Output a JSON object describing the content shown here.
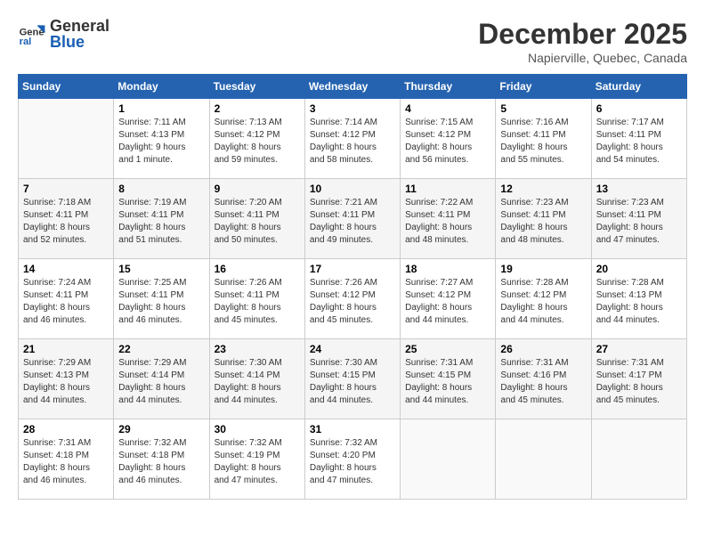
{
  "header": {
    "logo_general": "General",
    "logo_blue": "Blue",
    "month_title": "December 2025",
    "location": "Napierville, Quebec, Canada"
  },
  "days_of_week": [
    "Sunday",
    "Monday",
    "Tuesday",
    "Wednesday",
    "Thursday",
    "Friday",
    "Saturday"
  ],
  "weeks": [
    [
      {
        "day": "",
        "info": ""
      },
      {
        "day": "1",
        "info": "Sunrise: 7:11 AM\nSunset: 4:13 PM\nDaylight: 9 hours\nand 1 minute."
      },
      {
        "day": "2",
        "info": "Sunrise: 7:13 AM\nSunset: 4:12 PM\nDaylight: 8 hours\nand 59 minutes."
      },
      {
        "day": "3",
        "info": "Sunrise: 7:14 AM\nSunset: 4:12 PM\nDaylight: 8 hours\nand 58 minutes."
      },
      {
        "day": "4",
        "info": "Sunrise: 7:15 AM\nSunset: 4:12 PM\nDaylight: 8 hours\nand 56 minutes."
      },
      {
        "day": "5",
        "info": "Sunrise: 7:16 AM\nSunset: 4:11 PM\nDaylight: 8 hours\nand 55 minutes."
      },
      {
        "day": "6",
        "info": "Sunrise: 7:17 AM\nSunset: 4:11 PM\nDaylight: 8 hours\nand 54 minutes."
      }
    ],
    [
      {
        "day": "7",
        "info": "Sunrise: 7:18 AM\nSunset: 4:11 PM\nDaylight: 8 hours\nand 52 minutes."
      },
      {
        "day": "8",
        "info": "Sunrise: 7:19 AM\nSunset: 4:11 PM\nDaylight: 8 hours\nand 51 minutes."
      },
      {
        "day": "9",
        "info": "Sunrise: 7:20 AM\nSunset: 4:11 PM\nDaylight: 8 hours\nand 50 minutes."
      },
      {
        "day": "10",
        "info": "Sunrise: 7:21 AM\nSunset: 4:11 PM\nDaylight: 8 hours\nand 49 minutes."
      },
      {
        "day": "11",
        "info": "Sunrise: 7:22 AM\nSunset: 4:11 PM\nDaylight: 8 hours\nand 48 minutes."
      },
      {
        "day": "12",
        "info": "Sunrise: 7:23 AM\nSunset: 4:11 PM\nDaylight: 8 hours\nand 48 minutes."
      },
      {
        "day": "13",
        "info": "Sunrise: 7:23 AM\nSunset: 4:11 PM\nDaylight: 8 hours\nand 47 minutes."
      }
    ],
    [
      {
        "day": "14",
        "info": "Sunrise: 7:24 AM\nSunset: 4:11 PM\nDaylight: 8 hours\nand 46 minutes."
      },
      {
        "day": "15",
        "info": "Sunrise: 7:25 AM\nSunset: 4:11 PM\nDaylight: 8 hours\nand 46 minutes."
      },
      {
        "day": "16",
        "info": "Sunrise: 7:26 AM\nSunset: 4:11 PM\nDaylight: 8 hours\nand 45 minutes."
      },
      {
        "day": "17",
        "info": "Sunrise: 7:26 AM\nSunset: 4:12 PM\nDaylight: 8 hours\nand 45 minutes."
      },
      {
        "day": "18",
        "info": "Sunrise: 7:27 AM\nSunset: 4:12 PM\nDaylight: 8 hours\nand 44 minutes."
      },
      {
        "day": "19",
        "info": "Sunrise: 7:28 AM\nSunset: 4:12 PM\nDaylight: 8 hours\nand 44 minutes."
      },
      {
        "day": "20",
        "info": "Sunrise: 7:28 AM\nSunset: 4:13 PM\nDaylight: 8 hours\nand 44 minutes."
      }
    ],
    [
      {
        "day": "21",
        "info": "Sunrise: 7:29 AM\nSunset: 4:13 PM\nDaylight: 8 hours\nand 44 minutes."
      },
      {
        "day": "22",
        "info": "Sunrise: 7:29 AM\nSunset: 4:14 PM\nDaylight: 8 hours\nand 44 minutes."
      },
      {
        "day": "23",
        "info": "Sunrise: 7:30 AM\nSunset: 4:14 PM\nDaylight: 8 hours\nand 44 minutes."
      },
      {
        "day": "24",
        "info": "Sunrise: 7:30 AM\nSunset: 4:15 PM\nDaylight: 8 hours\nand 44 minutes."
      },
      {
        "day": "25",
        "info": "Sunrise: 7:31 AM\nSunset: 4:15 PM\nDaylight: 8 hours\nand 44 minutes."
      },
      {
        "day": "26",
        "info": "Sunrise: 7:31 AM\nSunset: 4:16 PM\nDaylight: 8 hours\nand 45 minutes."
      },
      {
        "day": "27",
        "info": "Sunrise: 7:31 AM\nSunset: 4:17 PM\nDaylight: 8 hours\nand 45 minutes."
      }
    ],
    [
      {
        "day": "28",
        "info": "Sunrise: 7:31 AM\nSunset: 4:18 PM\nDaylight: 8 hours\nand 46 minutes."
      },
      {
        "day": "29",
        "info": "Sunrise: 7:32 AM\nSunset: 4:18 PM\nDaylight: 8 hours\nand 46 minutes."
      },
      {
        "day": "30",
        "info": "Sunrise: 7:32 AM\nSunset: 4:19 PM\nDaylight: 8 hours\nand 47 minutes."
      },
      {
        "day": "31",
        "info": "Sunrise: 7:32 AM\nSunset: 4:20 PM\nDaylight: 8 hours\nand 47 minutes."
      },
      {
        "day": "",
        "info": ""
      },
      {
        "day": "",
        "info": ""
      },
      {
        "day": "",
        "info": ""
      }
    ]
  ]
}
